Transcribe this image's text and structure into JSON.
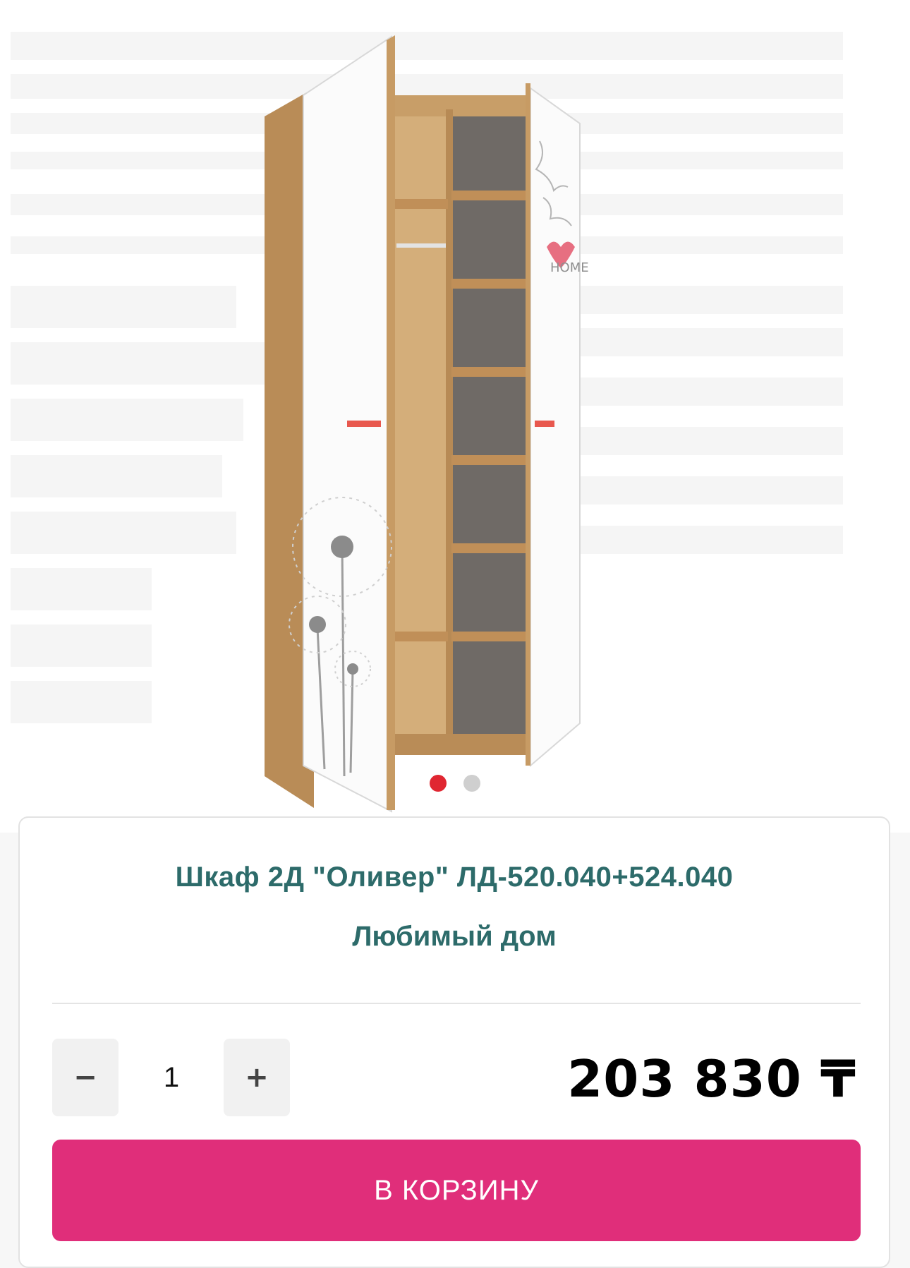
{
  "product": {
    "title": "Шкаф 2Д \"Оливер\" ЛД-520.040+524.040",
    "brand": "Любимый дом",
    "image_icon": "wardrobe-image",
    "gallery": {
      "total_slides": 2,
      "active_slide": 1
    }
  },
  "quantity": {
    "value": "1",
    "minus_label": "−",
    "plus_label": "+"
  },
  "price": "203 830 ₸",
  "cart_button_label": "В КОРЗИНУ",
  "colors": {
    "title_text": "#2d6b6a",
    "cart_button": "#e02e7a",
    "active_dot": "#e02631",
    "inactive_dot": "#cfcfcf"
  }
}
